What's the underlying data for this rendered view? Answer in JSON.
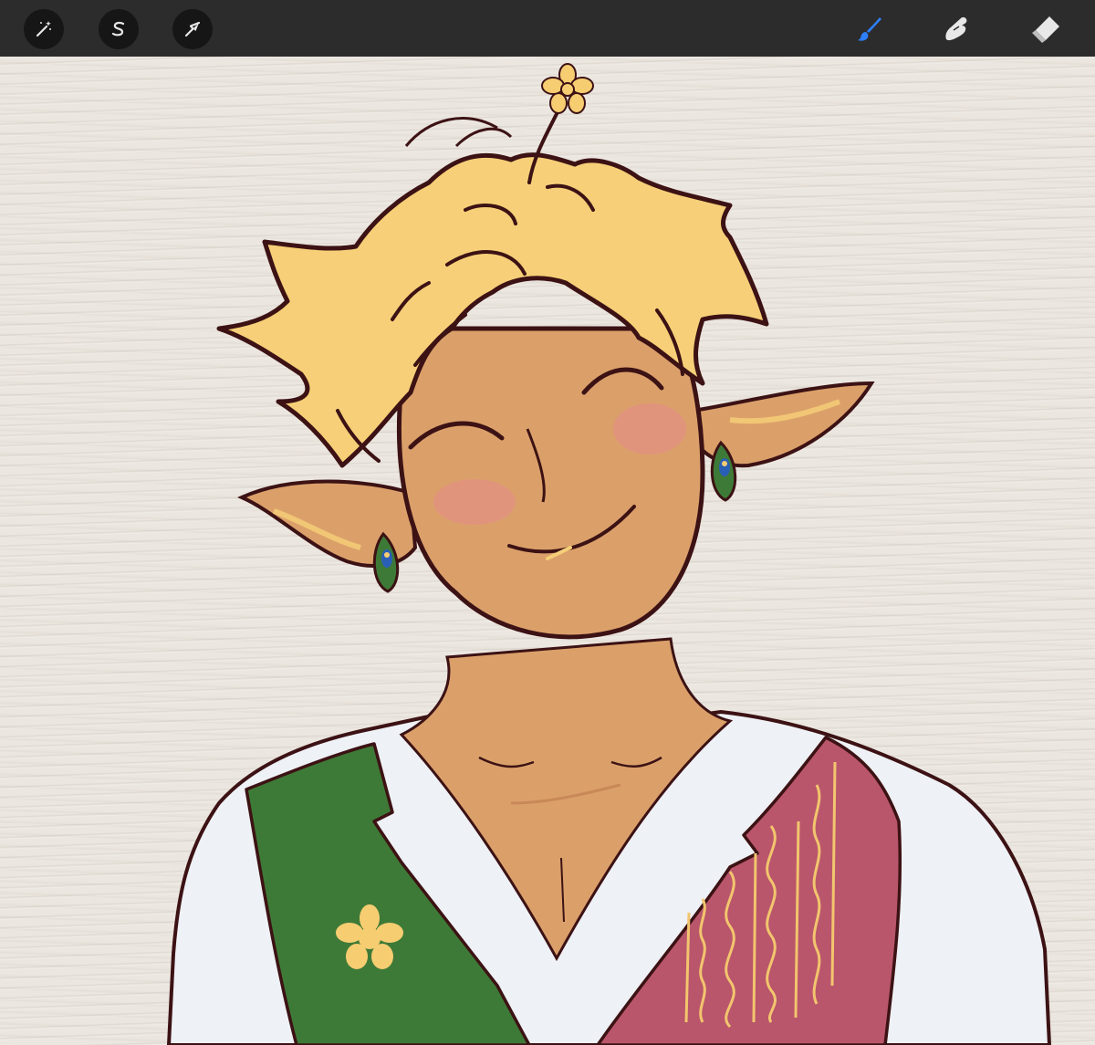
{
  "app": {
    "toolbar": {
      "left_tools": [
        {
          "name": "adjustments-wand",
          "icon": "magic-wand-icon"
        },
        {
          "name": "selection",
          "icon": "selection-s-icon"
        },
        {
          "name": "transform",
          "icon": "arrow-cursor-icon"
        }
      ],
      "right_tools": [
        {
          "name": "brush",
          "icon": "brush-icon",
          "active": true
        },
        {
          "name": "smudge",
          "icon": "smudge-finger-icon",
          "active": false
        },
        {
          "name": "eraser",
          "icon": "eraser-icon",
          "active": false
        }
      ]
    },
    "canvas": {
      "paper_texture": "watercolor-paper",
      "artwork": "elf-character-portrait"
    },
    "colors": {
      "toolbar_bg": "#2c2c2c",
      "active_tool": "#2d7ff9",
      "icon_default": "#e8e8e8",
      "paper": "#ebe6df",
      "hair": "#f6cf78",
      "skin": "#dda56e",
      "outline": "#3c1214",
      "shirt": "#eef1f5",
      "vest_green": "#3e7a37",
      "vest_pink": "#b9566b",
      "flower": "#f7cd72"
    }
  }
}
